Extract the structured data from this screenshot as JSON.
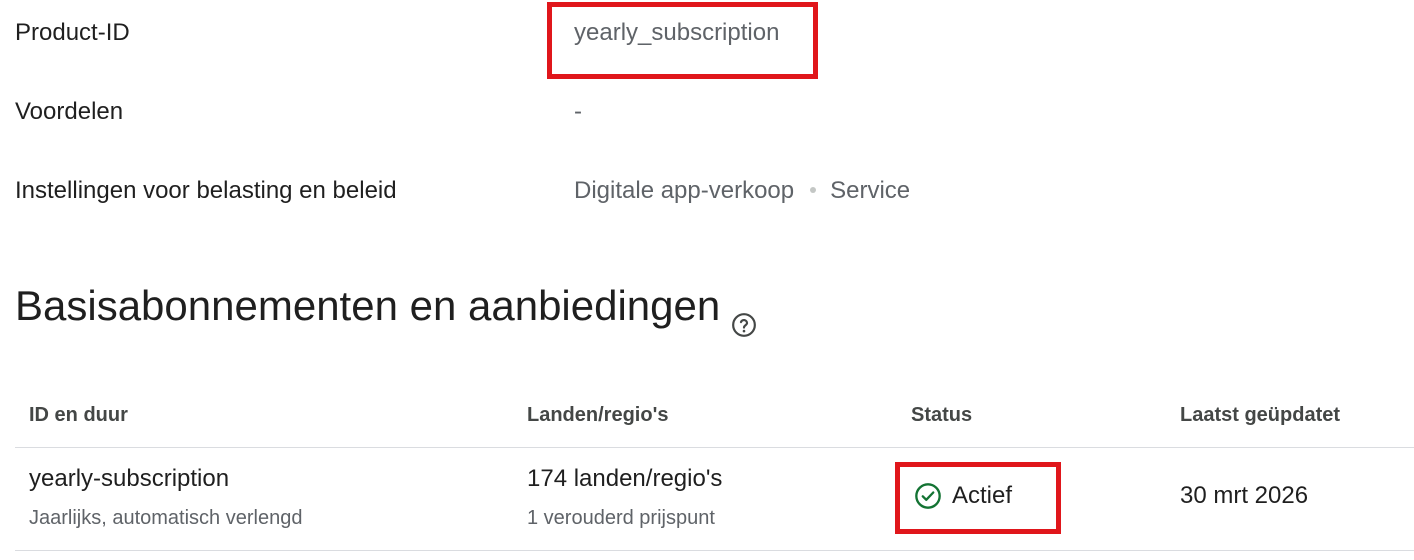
{
  "details": {
    "product_id": {
      "label": "Product-ID",
      "value": "yearly_subscription"
    },
    "benefits": {
      "label": "Voordelen",
      "value": "-"
    },
    "tax": {
      "label": "Instellingen voor belasting en beleid",
      "category": "Digitale app-verkoop",
      "type": "Service"
    }
  },
  "section": {
    "title": "Basisabonnementen en aanbiedingen",
    "help_icon": "help-circle-icon"
  },
  "table": {
    "headers": {
      "id": "ID en duur",
      "countries": "Landen/regio's",
      "status": "Status",
      "updated": "Laatst geüpdatet"
    },
    "rows": [
      {
        "id": "yearly-subscription",
        "duration": "Jaarlijks, automatisch verlengd",
        "countries": "174 landen/regio's",
        "price_note": "1 verouderd prijspunt",
        "status": "Actief",
        "status_icon": "check-circle-icon",
        "updated": "30 mrt 2026"
      }
    ]
  },
  "colors": {
    "highlight": "#e0161b",
    "status_active": "#137333",
    "muted_text": "#5f6368"
  }
}
